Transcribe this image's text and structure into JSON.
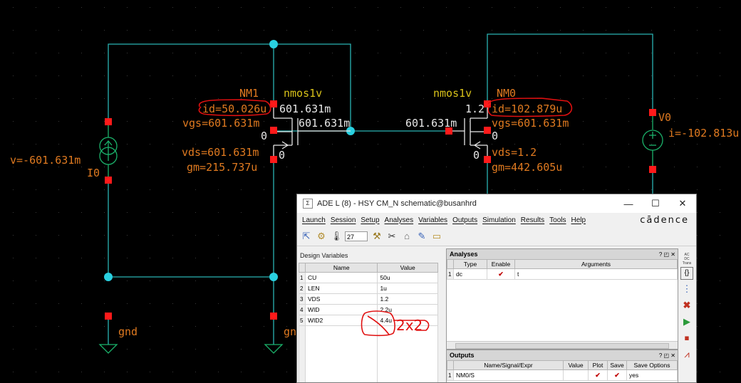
{
  "schematic": {
    "left_device": {
      "instance": "NM1",
      "model": "nmos1v",
      "id": "id=50.026u",
      "vgs": "vgs=601.631m",
      "vds": "vds=601.631m",
      "gm": "gm=215.737u",
      "drain_v": "601.631m",
      "gate_v": "601.631m",
      "zero_a": "0",
      "zero_b": "0"
    },
    "right_device": {
      "instance": "NM0",
      "model": "nmos1v",
      "id": "id=102.879u",
      "vgs": "vgs=601.631m",
      "vds": "vds=1.2",
      "gm": "gm=442.605u",
      "drain_v": "1.2",
      "gate_v": "601.631m",
      "zero_a": "0",
      "zero_b": "0"
    },
    "current_source": {
      "name": "I0",
      "v": "v=-601.631m"
    },
    "voltage_source": {
      "name": "V0",
      "i": "i=-102.813u"
    },
    "gnd_left": "gnd",
    "gnd_right": "gn",
    "annotation": "2x2"
  },
  "ade": {
    "title": "ADE L (8) - HSY CM_N schematic@busanhrd",
    "window_controls": [
      "—",
      "☐",
      "✕"
    ],
    "menu": [
      "Launch",
      "Session",
      "Setup",
      "Analyses",
      "Variables",
      "Outputs",
      "Simulation",
      "Results",
      "Tools",
      "Help"
    ],
    "brand": "cādence",
    "temperature": "27",
    "design_variables": {
      "header": "Design Variables",
      "columns": [
        "Name",
        "Value"
      ],
      "rows": [
        {
          "n": "1",
          "name": "CU",
          "value": "50u"
        },
        {
          "n": "2",
          "name": "LEN",
          "value": "1u"
        },
        {
          "n": "3",
          "name": "VDS",
          "value": "1.2"
        },
        {
          "n": "4",
          "name": "WID",
          "value": "2.2u"
        },
        {
          "n": "5",
          "name": "WID2",
          "value": "4.4u"
        }
      ]
    },
    "analyses": {
      "header": "Analyses",
      "columns": [
        "Type",
        "Enable",
        "Arguments"
      ],
      "rows": [
        {
          "n": "1",
          "type": "dc",
          "enable": "✔",
          "args": "t"
        }
      ]
    },
    "outputs": {
      "header": "Outputs",
      "columns": [
        "Name/Signal/Expr",
        "Value",
        "Plot",
        "Save",
        "Save Options"
      ],
      "rows": [
        {
          "n": "1",
          "name": "NM0/S",
          "value": "",
          "plot": "✔",
          "save": "✔",
          "opts": "yes"
        }
      ]
    },
    "dock_controls": "? ◰ ✕",
    "side_labels": {
      "ac": "AC",
      "dc": "DC",
      "tran": "Trans"
    }
  },
  "colors": {
    "background": "#000000",
    "wire": "#2ab4b4",
    "pin": "#ff1a1a",
    "label_orange": "#e07a20",
    "label_yellow": "#d9c21a",
    "label_white": "#e8e8e8",
    "annotation_red": "#e01010",
    "source_green": "#1bb36b"
  }
}
